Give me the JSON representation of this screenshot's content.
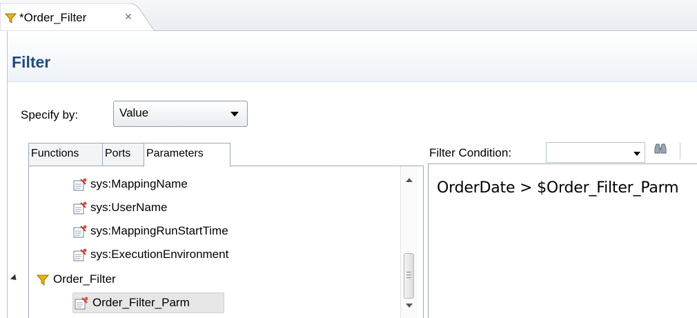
{
  "editor_tab": {
    "title": "*Order_Filter",
    "close_glyph": "✕"
  },
  "section": {
    "title": "Filter"
  },
  "specify": {
    "label": "Specify by:",
    "value": "Value"
  },
  "left_tabs": [
    {
      "label": "Functions"
    },
    {
      "label": "Ports"
    },
    {
      "label": "Parameters"
    }
  ],
  "tree": {
    "items": [
      {
        "label": "sys:MappingName"
      },
      {
        "label": "sys:UserName"
      },
      {
        "label": "sys:MappingRunStartTime"
      },
      {
        "label": "sys:ExecutionEnvironment"
      },
      {
        "label": "Order_Filter"
      },
      {
        "label": "Order_Filter_Parm"
      }
    ]
  },
  "condition": {
    "label": "Filter Condition:",
    "expression": "OrderDate > $Order_Filter_Parm"
  },
  "icons": {
    "filter": "funnel-icon",
    "parameter": "parameter-icon",
    "find": "binoculars-icon"
  },
  "colors": {
    "section_title": "#1e4a82",
    "filter_icon": "#e8b400"
  }
}
